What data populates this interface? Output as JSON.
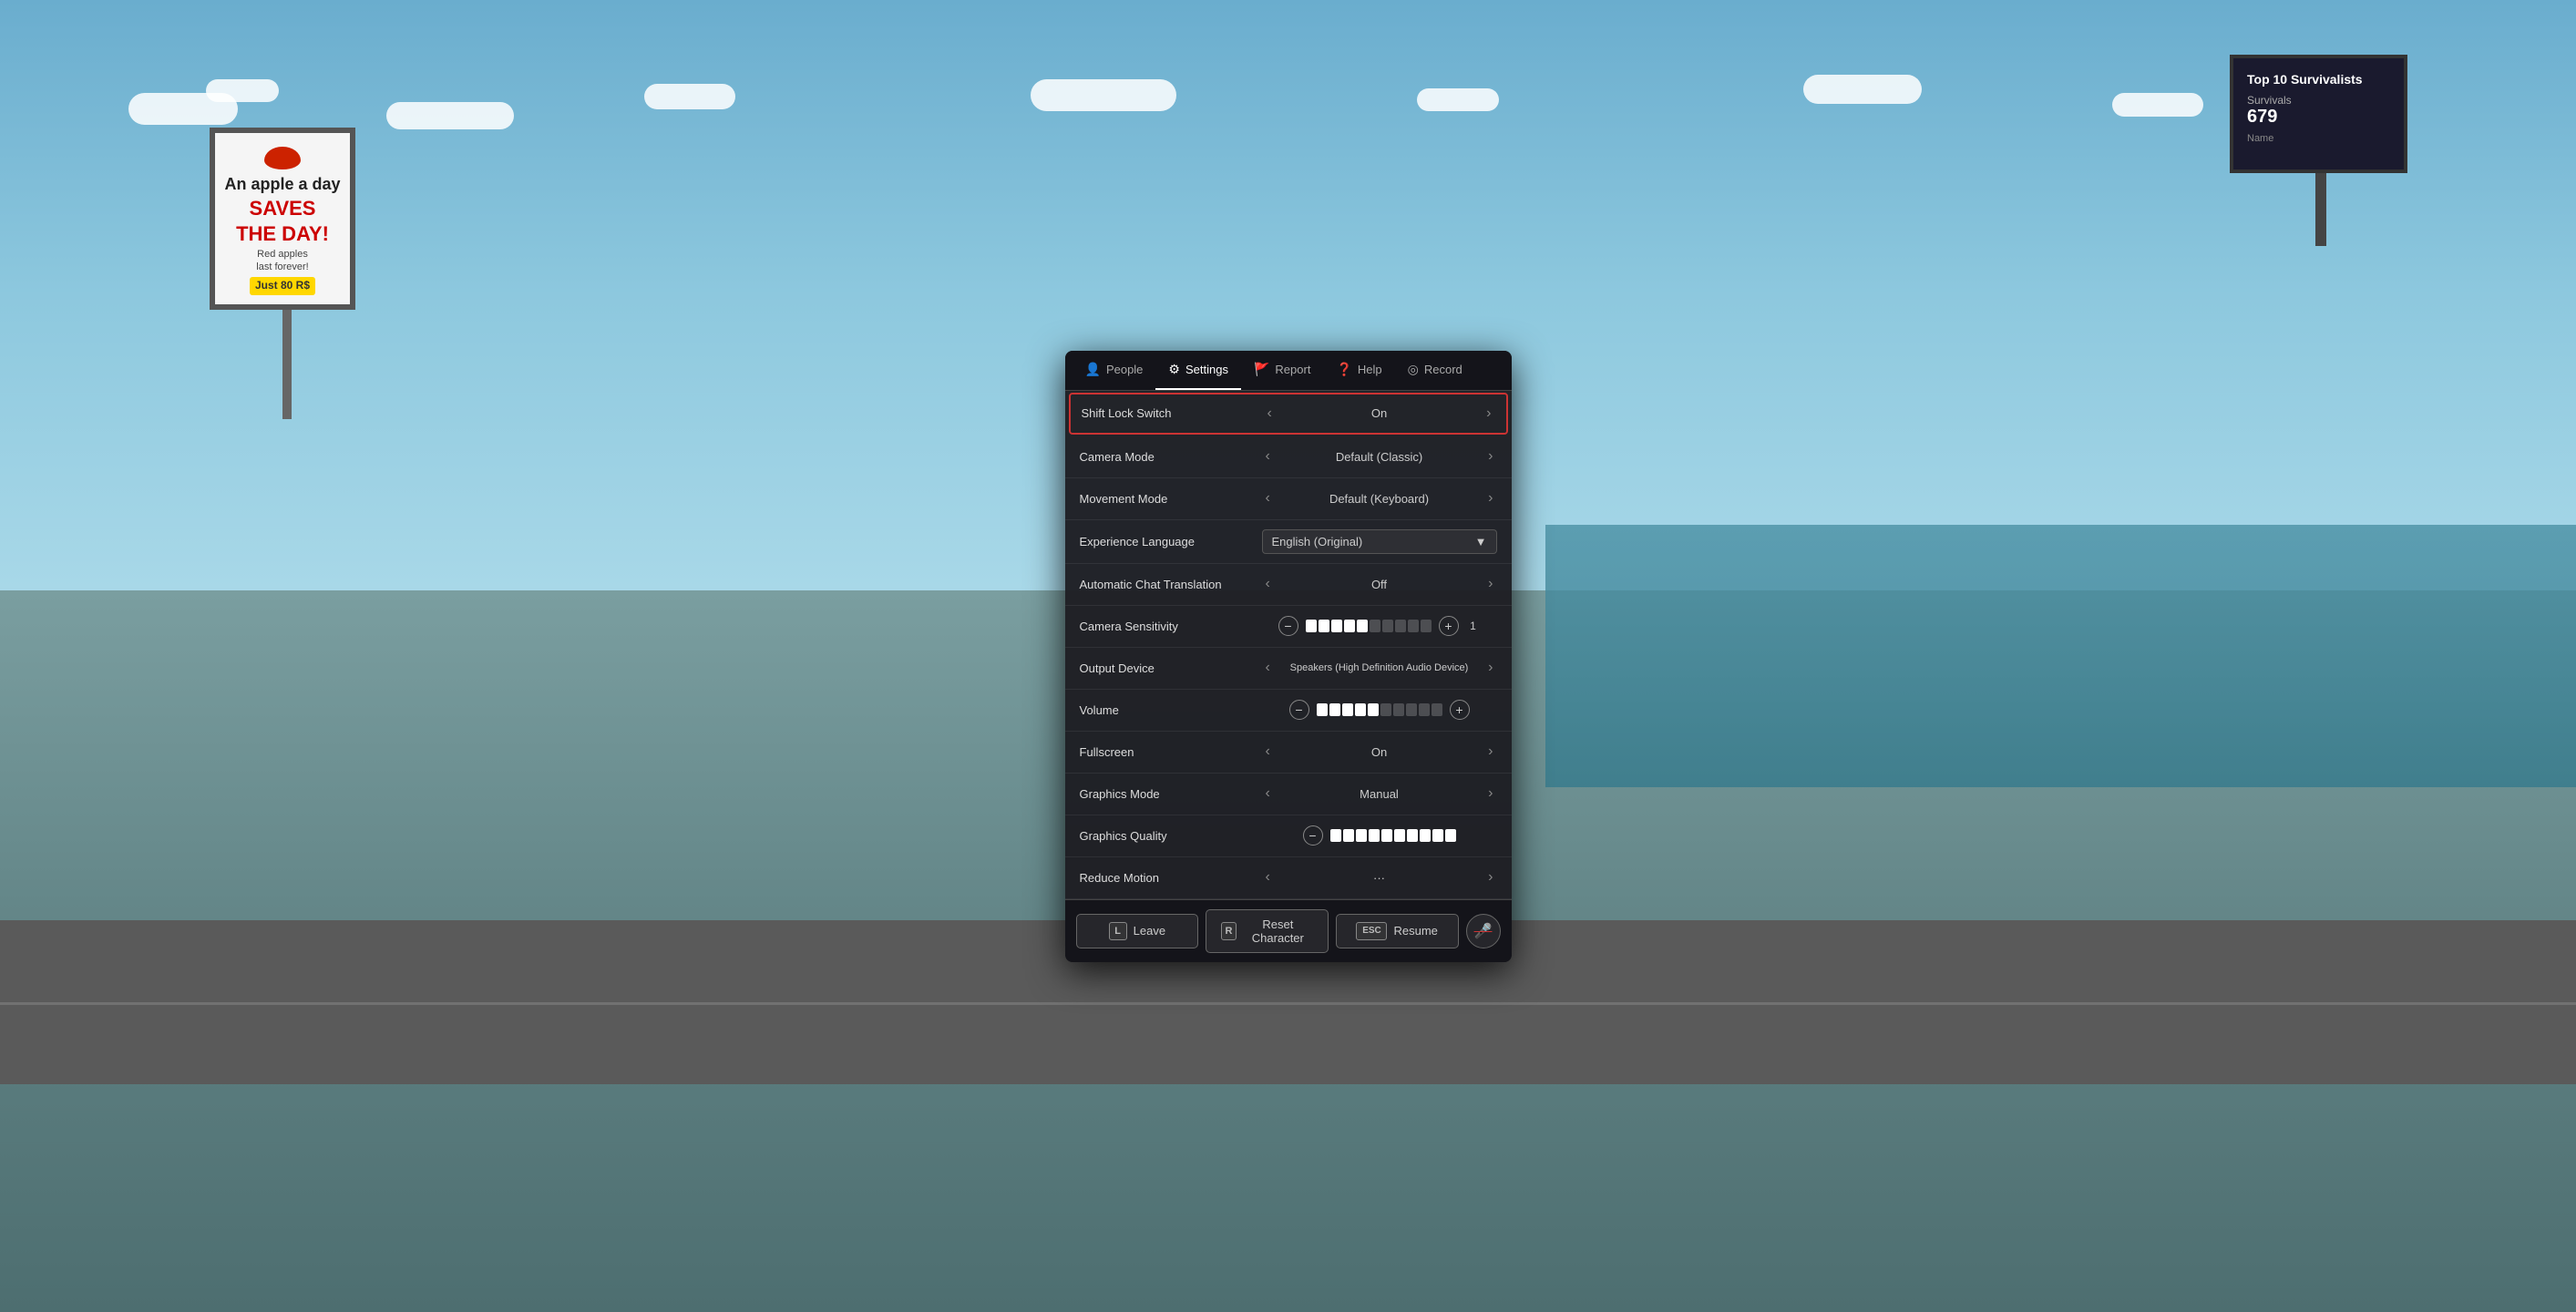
{
  "scene": {
    "billboard_left": {
      "line1": "An apple a day",
      "line2": "SAVES",
      "line3": "THE DAY!",
      "line4": "Red apples",
      "line5": "last forever!",
      "price": "Just 80 R$"
    },
    "billboard_right": {
      "title": "Top 10 Survivalists",
      "label": "Survivals",
      "value": "679",
      "name_label": "Name"
    }
  },
  "tabs": [
    {
      "id": "people",
      "label": "People",
      "icon": "👤",
      "active": false
    },
    {
      "id": "settings",
      "label": "Settings",
      "icon": "⚙",
      "active": true
    },
    {
      "id": "report",
      "label": "Report",
      "icon": "🚩",
      "active": false
    },
    {
      "id": "help",
      "label": "Help",
      "icon": "❓",
      "active": false
    },
    {
      "id": "record",
      "label": "Record",
      "icon": "◎",
      "active": false
    }
  ],
  "settings": [
    {
      "id": "shift-lock",
      "label": "Shift Lock Switch",
      "type": "toggle",
      "value": "On",
      "highlighted": true
    },
    {
      "id": "camera-mode",
      "label": "Camera Mode",
      "type": "toggle",
      "value": "Default (Classic)",
      "highlighted": false
    },
    {
      "id": "movement-mode",
      "label": "Movement Mode",
      "type": "toggle",
      "value": "Default (Keyboard)",
      "highlighted": false
    },
    {
      "id": "experience-language",
      "label": "Experience Language",
      "type": "dropdown",
      "value": "English (Original)",
      "highlighted": false
    },
    {
      "id": "auto-chat-translation",
      "label": "Automatic Chat Translation",
      "type": "toggle",
      "value": "Off",
      "highlighted": false
    },
    {
      "id": "camera-sensitivity",
      "label": "Camera Sensitivity",
      "type": "slider",
      "filled": 5,
      "total": 10,
      "numValue": "1",
      "highlighted": false
    },
    {
      "id": "output-device",
      "label": "Output Device",
      "type": "toggle",
      "value": "Speakers (High Definition Audio Device)",
      "highlighted": false
    },
    {
      "id": "volume",
      "label": "Volume",
      "type": "slider",
      "filled": 5,
      "total": 10,
      "numValue": "",
      "highlighted": false
    },
    {
      "id": "fullscreen",
      "label": "Fullscreen",
      "type": "toggle",
      "value": "On",
      "highlighted": false
    },
    {
      "id": "graphics-mode",
      "label": "Graphics Mode",
      "type": "toggle",
      "value": "Manual",
      "highlighted": false
    },
    {
      "id": "graphics-quality",
      "label": "Graphics Quality",
      "type": "slider-only",
      "filled": 10,
      "total": 10,
      "numValue": "",
      "highlighted": false
    },
    {
      "id": "reduce-motion",
      "label": "Reduce Motion",
      "type": "toggle-partial",
      "value": "...",
      "highlighted": false
    }
  ],
  "actions": [
    {
      "id": "leave",
      "key": "L",
      "label": "Leave"
    },
    {
      "id": "reset",
      "key": "R",
      "label": "Reset Character"
    },
    {
      "id": "resume",
      "key": "ESC",
      "label": "Resume"
    }
  ],
  "mic": {
    "icon": "🎤",
    "muted": true
  }
}
